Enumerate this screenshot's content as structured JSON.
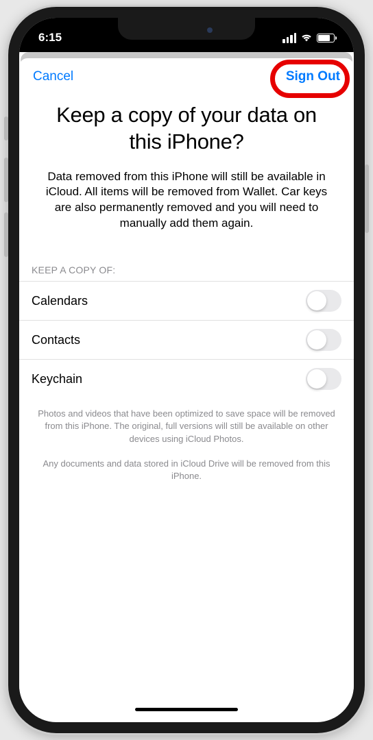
{
  "status": {
    "time": "6:15"
  },
  "nav": {
    "cancel": "Cancel",
    "signout": "Sign Out"
  },
  "title": "Keep a copy of your data on this iPhone?",
  "description": "Data removed from this iPhone will still be available in iCloud. All items will be removed from Wallet. Car keys are also permanently removed and you will need to manually add them again.",
  "section_header": "KEEP A COPY OF:",
  "rows": [
    {
      "label": "Calendars",
      "on": false
    },
    {
      "label": "Contacts",
      "on": false
    },
    {
      "label": "Keychain",
      "on": false
    }
  ],
  "footer1": "Photos and videos that have been optimized to save space will be removed from this iPhone. The original, full versions will still be available on other devices using iCloud Photos.",
  "footer2": "Any documents and data stored in iCloud Drive will be removed from this iPhone."
}
